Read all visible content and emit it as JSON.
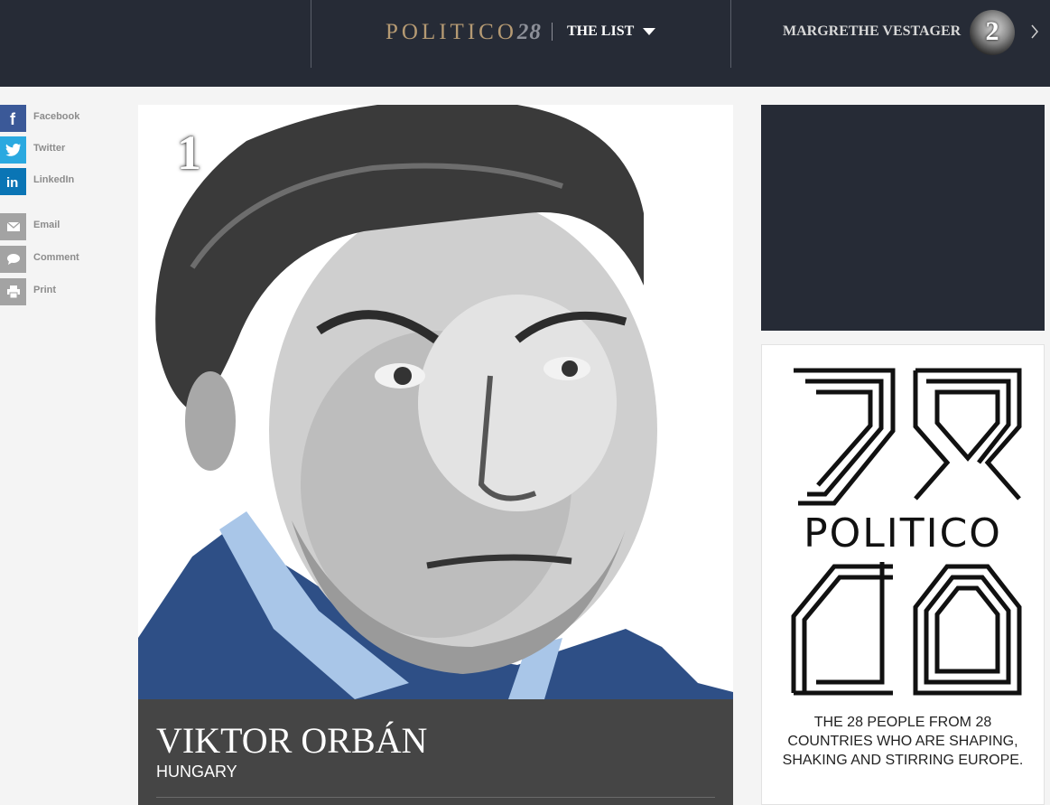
{
  "header": {
    "logo_text": "POLITICO",
    "logo_number": "28",
    "list_label": "THE LIST",
    "next_person": {
      "name": "MARGRETHE VESTAGER",
      "rank": "2"
    }
  },
  "social": {
    "items": [
      {
        "label": "Facebook",
        "icon": "facebook-icon",
        "color": "#3b5998"
      },
      {
        "label": "Twitter",
        "icon": "twitter-icon",
        "color": "#2aa9e0"
      },
      {
        "label": "LinkedIn",
        "icon": "linkedin-icon",
        "color": "#0a75b5"
      },
      {
        "label": "Email",
        "icon": "email-icon",
        "color": "#a3a3a3"
      },
      {
        "label": "Comment",
        "icon": "comment-icon",
        "color": "#a3a3a3"
      },
      {
        "label": "Print",
        "icon": "print-icon",
        "color": "#a3a3a3"
      }
    ]
  },
  "feature": {
    "rank": "1",
    "name": "VIKTOR ORBÁN",
    "country": "HUNGARY"
  },
  "promo": {
    "logo_word": "POLITICO",
    "logo_number": "28",
    "tagline": "THE 28 PEOPLE FROM 28 COUNTRIES WHO ARE SHAPING, SHAKING AND STIRRING EUROPE."
  },
  "colors": {
    "nav_bg": "#262b36",
    "logo_gold": "#b59a73",
    "caption_bg": "#454545"
  }
}
